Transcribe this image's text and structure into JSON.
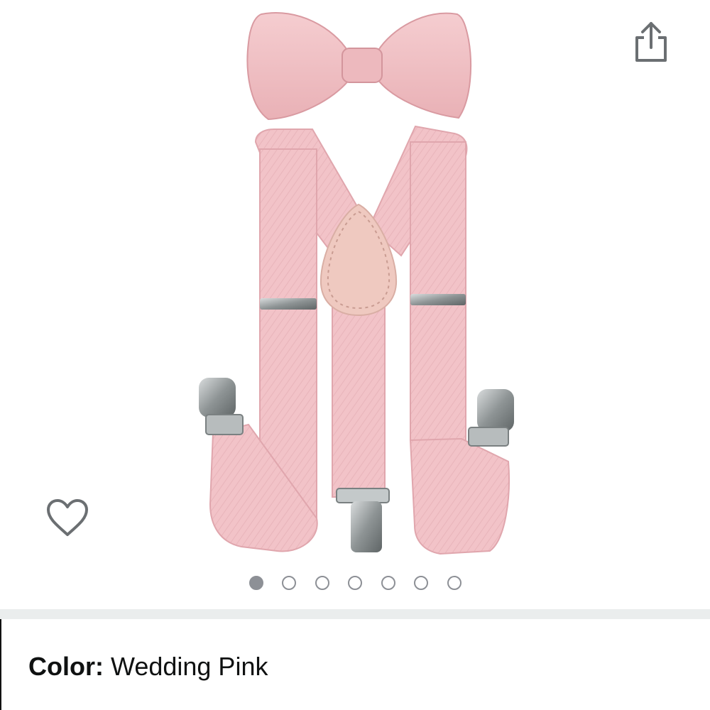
{
  "product": {
    "image_alt": "Pink kids suspenders and bow tie set"
  },
  "actions": {
    "share_icon": "share-icon",
    "wishlist_icon": "heart-outline-icon"
  },
  "carousel": {
    "total": 7,
    "active_index": 0
  },
  "variation": {
    "label": "Color:",
    "value": "Wedding Pink"
  },
  "colors": {
    "product_pink": "#f2c3c8",
    "product_pink_dark": "#e3a9b0",
    "leather_patch": "#efc9c0",
    "icon_gray": "#6b6f72",
    "dot_gray": "#8d9096"
  }
}
